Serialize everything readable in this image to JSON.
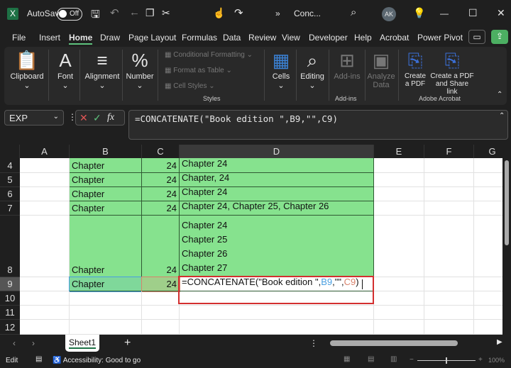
{
  "titlebar": {
    "app_icon": "X",
    "autosave": "AutoSave",
    "toggle": "Off",
    "doc_title": "Conc...",
    "avatar": "AK",
    "overflow": "»"
  },
  "menu_tabs": [
    "File",
    "Insert",
    "Home",
    "Draw",
    "Page Layout",
    "Formulas",
    "Data",
    "Review",
    "View",
    "Developer",
    "Help",
    "Acrobat",
    "Power Pivot"
  ],
  "ribbon": {
    "clipboard": "Clipboard",
    "font": "Font",
    "alignment": "Alignment",
    "number": "Number",
    "cond_fmt": "Conditional Formatting",
    "fmt_table": "Format as Table",
    "cell_styles": "Cell Styles",
    "styles": "Styles",
    "cells": "Cells",
    "editing": "Editing",
    "addins": "Add-ins",
    "addins_group": "Add-ins",
    "analyze1": "Analyze",
    "analyze2": "Data",
    "create_pdf1": "Create",
    "create_pdf2": "a PDF",
    "share1": "Create a PDF",
    "share2": "and Share link",
    "adobe": "Adobe Acrobat"
  },
  "formula_bar": {
    "name_box": "EXP",
    "formula": "=CONCATENATE(\"Book edition \",B9,\"\",C9)",
    "fx": "fx"
  },
  "columns": [
    "A",
    "B",
    "C",
    "D",
    "E",
    "F",
    "G"
  ],
  "rows": [
    {
      "n": "4",
      "b": "Chapter",
      "c": "24",
      "d": "Chapter 24"
    },
    {
      "n": "5",
      "b": "Chapter",
      "c": "24",
      "d": "Chapter, 24"
    },
    {
      "n": "6",
      "b": "Chapter",
      "c": "24",
      "d": "Chapter 24"
    },
    {
      "n": "7",
      "b": "Chapter",
      "c": "24",
      "d": "Chapter 24, Chapter 25, Chapter 26"
    },
    {
      "n": "8",
      "b": "Chapter",
      "c": "24",
      "d": "Chapter 24\nChapter 25\nChapter 26\nChapter 27"
    },
    {
      "n": "9",
      "b": "Chapter",
      "c": "24",
      "d": ""
    },
    {
      "n": "10",
      "b": "",
      "c": "",
      "d": ""
    },
    {
      "n": "11",
      "b": "",
      "c": "",
      "d": ""
    },
    {
      "n": "12",
      "b": "",
      "c": "",
      "d": ""
    }
  ],
  "edit_cell": {
    "p1": "=CONCATENATE(\"Book edition \",",
    "ref1": "B9",
    "p2": ",\"\",",
    "ref2": "C9",
    "p3": ")"
  },
  "sheet_tab": "Sheet1",
  "status": {
    "mode": "Edit",
    "accessibility": "Accessibility: Good to go",
    "zoom": "100%"
  },
  "colors": {
    "fill": "#86e28e",
    "highlight": "#d32f2f",
    "ref1": "#4a9fe0",
    "ref2": "#d9826b"
  }
}
